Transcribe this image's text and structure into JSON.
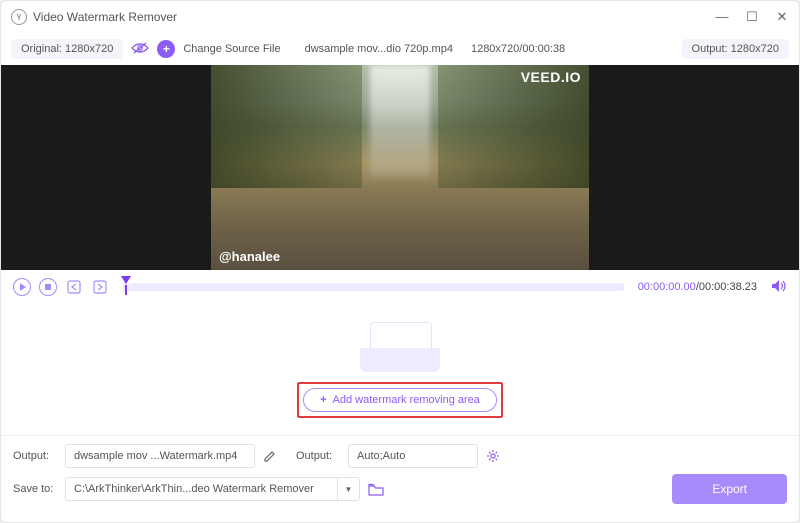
{
  "app": {
    "title": "Video Watermark Remover"
  },
  "topbar": {
    "original_label": "Original: 1280x720",
    "change_source": "Change Source File",
    "filename": "dwsample mov...dio 720p.mp4",
    "dims_time": "1280x720/00:00:38",
    "output_label": "Output: 1280x720"
  },
  "frame": {
    "watermark_tr": "VEED.IO",
    "watermark_bl": "@hanalee"
  },
  "player": {
    "current": "00:00:00.00",
    "sep": "/",
    "duration": "00:00:38.23"
  },
  "drop": {
    "add_button": "Add watermark removing area"
  },
  "bottom": {
    "output_lab": "Output:",
    "output_file": "dwsample mov ...Watermark.mp4",
    "output2_lab": "Output:",
    "output2_val": "Auto;Auto",
    "saveto_lab": "Save to:",
    "saveto_val": "C:\\ArkThinker\\ArkThin...deo Watermark Remover",
    "export": "Export"
  }
}
